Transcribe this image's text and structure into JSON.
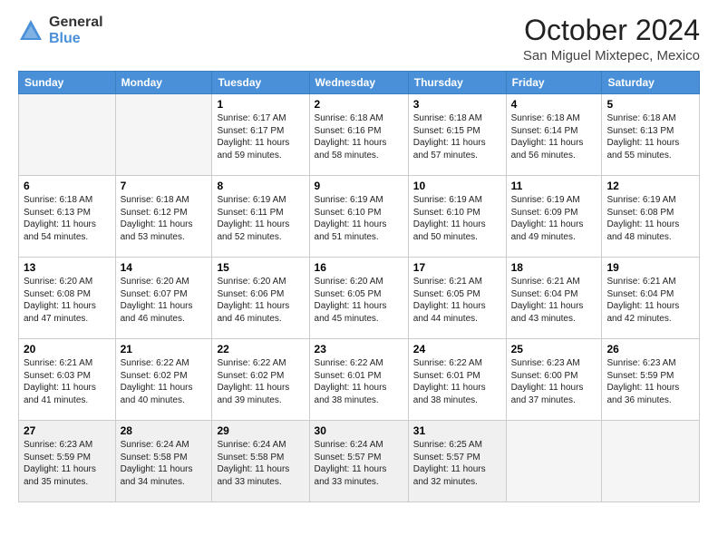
{
  "logo": {
    "general": "General",
    "blue": "Blue"
  },
  "title": "October 2024",
  "location": "San Miguel Mixtepec, Mexico",
  "days_header": [
    "Sunday",
    "Monday",
    "Tuesday",
    "Wednesday",
    "Thursday",
    "Friday",
    "Saturday"
  ],
  "weeks": [
    [
      {
        "day": "",
        "content": ""
      },
      {
        "day": "",
        "content": ""
      },
      {
        "day": "1",
        "content": "Sunrise: 6:17 AM\nSunset: 6:17 PM\nDaylight: 11 hours and 59 minutes."
      },
      {
        "day": "2",
        "content": "Sunrise: 6:18 AM\nSunset: 6:16 PM\nDaylight: 11 hours and 58 minutes."
      },
      {
        "day": "3",
        "content": "Sunrise: 6:18 AM\nSunset: 6:15 PM\nDaylight: 11 hours and 57 minutes."
      },
      {
        "day": "4",
        "content": "Sunrise: 6:18 AM\nSunset: 6:14 PM\nDaylight: 11 hours and 56 minutes."
      },
      {
        "day": "5",
        "content": "Sunrise: 6:18 AM\nSunset: 6:13 PM\nDaylight: 11 hours and 55 minutes."
      }
    ],
    [
      {
        "day": "6",
        "content": "Sunrise: 6:18 AM\nSunset: 6:13 PM\nDaylight: 11 hours and 54 minutes."
      },
      {
        "day": "7",
        "content": "Sunrise: 6:18 AM\nSunset: 6:12 PM\nDaylight: 11 hours and 53 minutes."
      },
      {
        "day": "8",
        "content": "Sunrise: 6:19 AM\nSunset: 6:11 PM\nDaylight: 11 hours and 52 minutes."
      },
      {
        "day": "9",
        "content": "Sunrise: 6:19 AM\nSunset: 6:10 PM\nDaylight: 11 hours and 51 minutes."
      },
      {
        "day": "10",
        "content": "Sunrise: 6:19 AM\nSunset: 6:10 PM\nDaylight: 11 hours and 50 minutes."
      },
      {
        "day": "11",
        "content": "Sunrise: 6:19 AM\nSunset: 6:09 PM\nDaylight: 11 hours and 49 minutes."
      },
      {
        "day": "12",
        "content": "Sunrise: 6:19 AM\nSunset: 6:08 PM\nDaylight: 11 hours and 48 minutes."
      }
    ],
    [
      {
        "day": "13",
        "content": "Sunrise: 6:20 AM\nSunset: 6:08 PM\nDaylight: 11 hours and 47 minutes."
      },
      {
        "day": "14",
        "content": "Sunrise: 6:20 AM\nSunset: 6:07 PM\nDaylight: 11 hours and 46 minutes."
      },
      {
        "day": "15",
        "content": "Sunrise: 6:20 AM\nSunset: 6:06 PM\nDaylight: 11 hours and 46 minutes."
      },
      {
        "day": "16",
        "content": "Sunrise: 6:20 AM\nSunset: 6:05 PM\nDaylight: 11 hours and 45 minutes."
      },
      {
        "day": "17",
        "content": "Sunrise: 6:21 AM\nSunset: 6:05 PM\nDaylight: 11 hours and 44 minutes."
      },
      {
        "day": "18",
        "content": "Sunrise: 6:21 AM\nSunset: 6:04 PM\nDaylight: 11 hours and 43 minutes."
      },
      {
        "day": "19",
        "content": "Sunrise: 6:21 AM\nSunset: 6:04 PM\nDaylight: 11 hours and 42 minutes."
      }
    ],
    [
      {
        "day": "20",
        "content": "Sunrise: 6:21 AM\nSunset: 6:03 PM\nDaylight: 11 hours and 41 minutes."
      },
      {
        "day": "21",
        "content": "Sunrise: 6:22 AM\nSunset: 6:02 PM\nDaylight: 11 hours and 40 minutes."
      },
      {
        "day": "22",
        "content": "Sunrise: 6:22 AM\nSunset: 6:02 PM\nDaylight: 11 hours and 39 minutes."
      },
      {
        "day": "23",
        "content": "Sunrise: 6:22 AM\nSunset: 6:01 PM\nDaylight: 11 hours and 38 minutes."
      },
      {
        "day": "24",
        "content": "Sunrise: 6:22 AM\nSunset: 6:01 PM\nDaylight: 11 hours and 38 minutes."
      },
      {
        "day": "25",
        "content": "Sunrise: 6:23 AM\nSunset: 6:00 PM\nDaylight: 11 hours and 37 minutes."
      },
      {
        "day": "26",
        "content": "Sunrise: 6:23 AM\nSunset: 5:59 PM\nDaylight: 11 hours and 36 minutes."
      }
    ],
    [
      {
        "day": "27",
        "content": "Sunrise: 6:23 AM\nSunset: 5:59 PM\nDaylight: 11 hours and 35 minutes."
      },
      {
        "day": "28",
        "content": "Sunrise: 6:24 AM\nSunset: 5:58 PM\nDaylight: 11 hours and 34 minutes."
      },
      {
        "day": "29",
        "content": "Sunrise: 6:24 AM\nSunset: 5:58 PM\nDaylight: 11 hours and 33 minutes."
      },
      {
        "day": "30",
        "content": "Sunrise: 6:24 AM\nSunset: 5:57 PM\nDaylight: 11 hours and 33 minutes."
      },
      {
        "day": "31",
        "content": "Sunrise: 6:25 AM\nSunset: 5:57 PM\nDaylight: 11 hours and 32 minutes."
      },
      {
        "day": "",
        "content": ""
      },
      {
        "day": "",
        "content": ""
      }
    ]
  ]
}
